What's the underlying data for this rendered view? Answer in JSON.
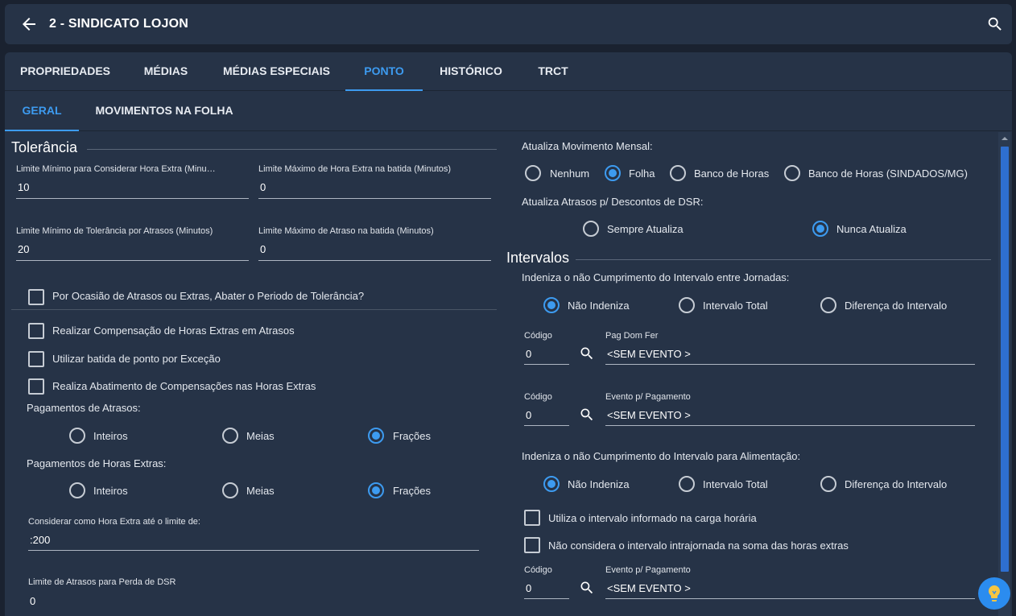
{
  "header": {
    "title": "2 - SINDICATO LOJON"
  },
  "tabs": [
    "PROPRIEDADES",
    "MÉDIAS",
    "MÉDIAS ESPECIAIS",
    "PONTO",
    "HISTÓRICO",
    "TRCT"
  ],
  "subtabs": [
    "GERAL",
    "MOVIMENTOS NA FOLHA"
  ],
  "tolerancia": {
    "title": "Tolerância",
    "fields": [
      {
        "label": "Limite Mínimo para Considerar Hora Extra (Minutos)",
        "value": "10"
      },
      {
        "label": "Limite Máximo de Hora Extra na batida (Minutos)",
        "value": "0"
      },
      {
        "label": "Limite Mínimo de Tolerância por Atrasos (Minutos)",
        "value": "20"
      },
      {
        "label": "Limite Máximo de Atraso na batida (Minutos)",
        "value": "0"
      }
    ],
    "check_abater": "Por Ocasião de Atrasos ou Extras, Abater o Periodo de Tolerância?"
  },
  "checks": [
    "Realizar Compensação de Horas Extras em Atrasos",
    "Utilizar batida de ponto por Exceção",
    "Realiza Abatimento de Compensações nas Horas Extras"
  ],
  "pagamento_atrasos": {
    "label": "Pagamentos de Atrasos:",
    "options": [
      "Inteiros",
      "Meias",
      "Frações"
    ],
    "selected": "Frações"
  },
  "pagamento_extras": {
    "label": "Pagamentos de Horas Extras:",
    "options": [
      "Inteiros",
      "Meias",
      "Frações"
    ],
    "selected": "Frações"
  },
  "limite_hora_extra": {
    "label": "Considerar como Hora Extra até o limite de:",
    "value": ":200"
  },
  "limite_dsr": {
    "label": "Limite de Atrasos para Perda de DSR",
    "value": "0"
  },
  "atualiza_movimento": {
    "label": "Atualiza Movimento Mensal:",
    "options": [
      "Nenhum",
      "Folha",
      "Banco de Horas",
      "Banco de Horas (SINDADOS/MG)"
    ],
    "selected": "Folha"
  },
  "atualiza_atrasos": {
    "label": "Atualiza Atrasos p/ Descontos de DSR:",
    "options": [
      "Sempre Atualiza",
      "Nunca Atualiza"
    ],
    "selected": "Nunca Atualiza"
  },
  "intervalos": {
    "title": "Intervalos",
    "jornadas": {
      "label": "Indeniza o não Cumprimento do Intervalo entre Jornadas:",
      "options": [
        "Não Indeniza",
        "Intervalo Total",
        "Diferença do Intervalo"
      ],
      "selected": "Não Indeniza"
    },
    "evento1": {
      "code_label": "Código",
      "code": "0",
      "event_label": "Pag Dom Fer",
      "event": "<SEM EVENTO >"
    },
    "evento2": {
      "code_label": "Código",
      "code": "0",
      "event_label": "Evento p/ Pagamento",
      "event": "<SEM EVENTO >"
    },
    "alimentacao": {
      "label": "Indeniza o não Cumprimento do Intervalo para Alimentação:",
      "options": [
        "Não Indeniza",
        "Intervalo Total",
        "Diferença do Intervalo"
      ],
      "selected": "Não Indeniza"
    },
    "check_carga": "Utiliza o intervalo informado na carga horária",
    "check_intrajornada": "Não considera o intervalo intrajornada na soma das horas extras",
    "evento3": {
      "code_label": "Código",
      "code": "0",
      "event_label": "Evento p/ Pagamento",
      "event": "<SEM EVENTO >"
    }
  },
  "colors": {
    "accent": "#3d9bf0",
    "panel": "#263347",
    "background": "#1a2230"
  }
}
